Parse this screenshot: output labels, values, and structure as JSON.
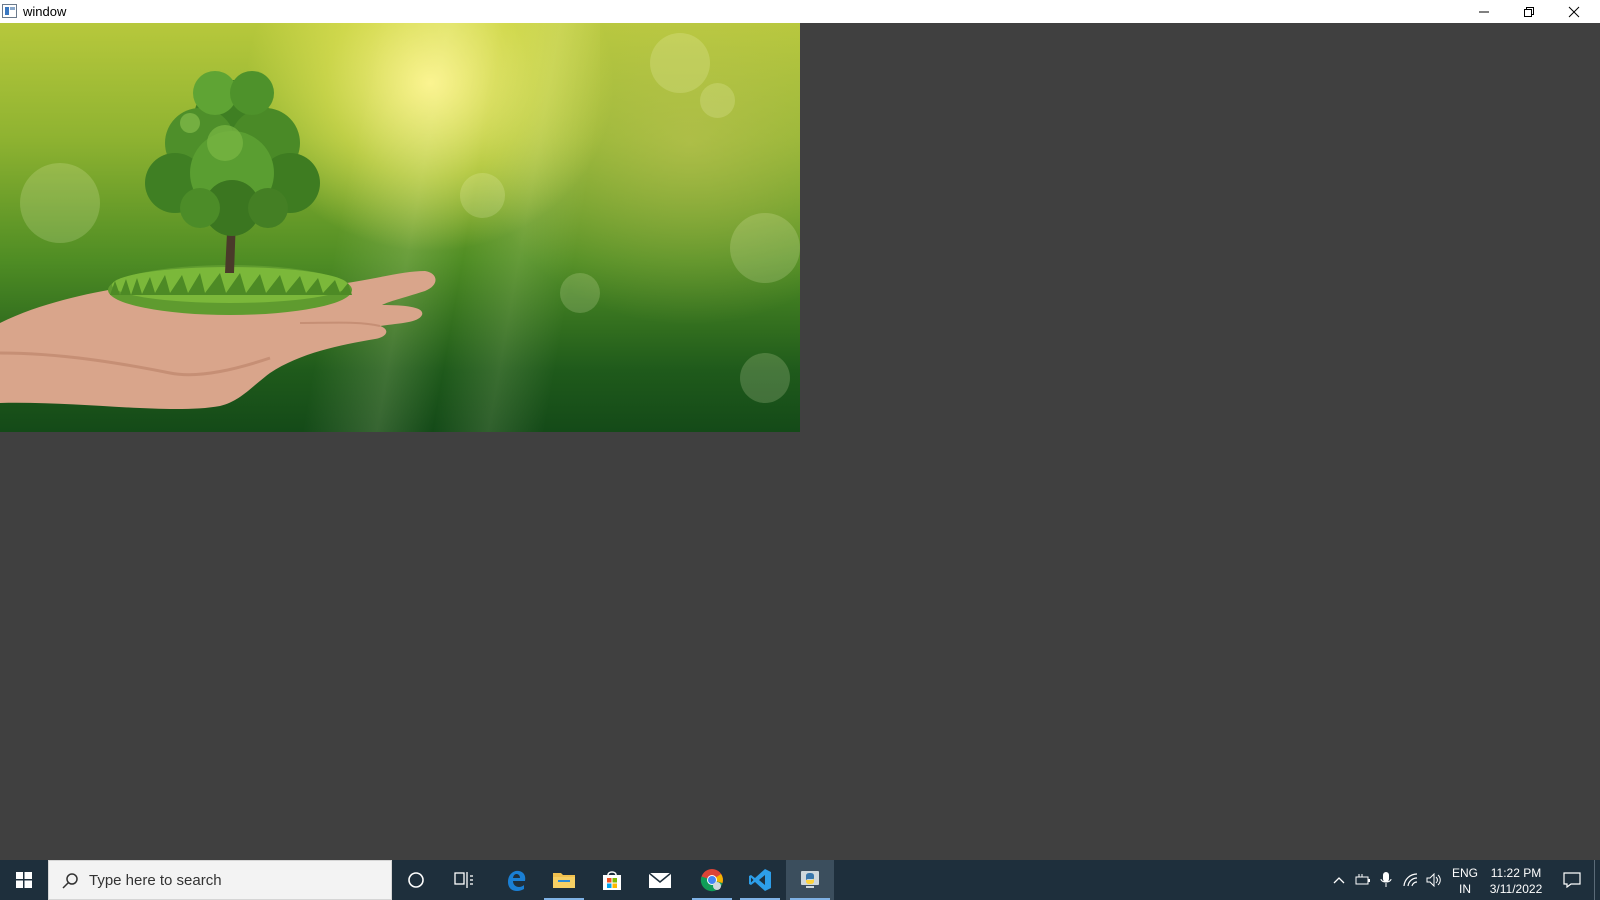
{
  "window": {
    "title": "window",
    "buttons": {
      "minimize": "minimize-icon",
      "restore": "restore-icon",
      "close": "close-icon"
    }
  },
  "canvas": {
    "image_description_icon": "photo-hand-holding-tree",
    "background_color": "#404040"
  },
  "taskbar": {
    "search_placeholder": "Type here to search",
    "pinned_apps": [
      {
        "name": "cortana",
        "icon": "cortana-circle-icon"
      },
      {
        "name": "task-view",
        "icon": "task-view-icon"
      },
      {
        "name": "edge",
        "icon": "edge-icon"
      },
      {
        "name": "file-explorer",
        "icon": "folder-icon",
        "running": true
      },
      {
        "name": "microsoft-store",
        "icon": "store-icon"
      },
      {
        "name": "mail",
        "icon": "mail-icon"
      },
      {
        "name": "chrome",
        "icon": "chrome-icon",
        "running": true
      },
      {
        "name": "vscode",
        "icon": "vscode-icon",
        "running": true
      },
      {
        "name": "python",
        "icon": "python-icon",
        "running": true,
        "active": true
      }
    ],
    "tray": {
      "language_line1": "ENG",
      "language_line2": "IN",
      "time": "11:22 PM",
      "date": "3/11/2022"
    },
    "colors": {
      "background": "#1e2f3c",
      "active_underline": "#7fb2e5"
    }
  }
}
